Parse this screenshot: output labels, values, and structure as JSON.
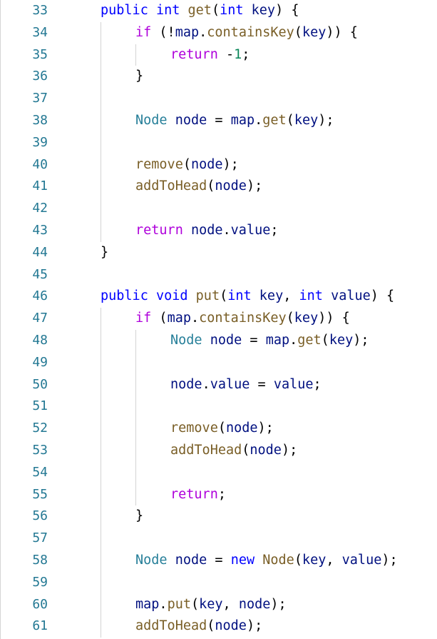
{
  "editor": {
    "lines": [
      {
        "n": "33",
        "indent": 1,
        "tokens": [
          [
            "kw",
            "public"
          ],
          [
            "pl",
            " "
          ],
          [
            "kw",
            "int"
          ],
          [
            "pl",
            " "
          ],
          [
            "fn",
            "get"
          ],
          [
            "pl",
            "("
          ],
          [
            "kw",
            "int"
          ],
          [
            "pl",
            " "
          ],
          [
            "var",
            "key"
          ],
          [
            "pl",
            ") {"
          ]
        ]
      },
      {
        "n": "34",
        "indent": 2,
        "tokens": [
          [
            "ctl",
            "if"
          ],
          [
            "pl",
            " (!"
          ],
          [
            "var",
            "map"
          ],
          [
            "pl",
            "."
          ],
          [
            "fn",
            "containsKey"
          ],
          [
            "pl",
            "("
          ],
          [
            "var",
            "key"
          ],
          [
            "pl",
            ")) {"
          ]
        ]
      },
      {
        "n": "35",
        "indent": 3,
        "tokens": [
          [
            "ctl",
            "return"
          ],
          [
            "pl",
            " -"
          ],
          [
            "num",
            "1"
          ],
          [
            "pl",
            ";"
          ]
        ]
      },
      {
        "n": "36",
        "indent": 2,
        "tokens": [
          [
            "pl",
            "}"
          ]
        ]
      },
      {
        "n": "37",
        "indent": 0,
        "tokens": []
      },
      {
        "n": "38",
        "indent": 2,
        "tokens": [
          [
            "ty",
            "Node"
          ],
          [
            "pl",
            " "
          ],
          [
            "var",
            "node"
          ],
          [
            "pl",
            " = "
          ],
          [
            "var",
            "map"
          ],
          [
            "pl",
            "."
          ],
          [
            "fn",
            "get"
          ],
          [
            "pl",
            "("
          ],
          [
            "var",
            "key"
          ],
          [
            "pl",
            ");"
          ]
        ]
      },
      {
        "n": "39",
        "indent": 0,
        "tokens": []
      },
      {
        "n": "40",
        "indent": 2,
        "tokens": [
          [
            "fn",
            "remove"
          ],
          [
            "pl",
            "("
          ],
          [
            "var",
            "node"
          ],
          [
            "pl",
            ");"
          ]
        ]
      },
      {
        "n": "41",
        "indent": 2,
        "tokens": [
          [
            "fn",
            "addToHead"
          ],
          [
            "pl",
            "("
          ],
          [
            "var",
            "node"
          ],
          [
            "pl",
            ");"
          ]
        ]
      },
      {
        "n": "42",
        "indent": 0,
        "tokens": []
      },
      {
        "n": "43",
        "indent": 2,
        "tokens": [
          [
            "ctl",
            "return"
          ],
          [
            "pl",
            " "
          ],
          [
            "var",
            "node"
          ],
          [
            "pl",
            "."
          ],
          [
            "var",
            "value"
          ],
          [
            "pl",
            ";"
          ]
        ]
      },
      {
        "n": "44",
        "indent": 1,
        "tokens": [
          [
            "pl",
            "}"
          ]
        ]
      },
      {
        "n": "45",
        "indent": 0,
        "tokens": []
      },
      {
        "n": "46",
        "indent": 1,
        "tokens": [
          [
            "kw",
            "public"
          ],
          [
            "pl",
            " "
          ],
          [
            "kw",
            "void"
          ],
          [
            "pl",
            " "
          ],
          [
            "fn",
            "put"
          ],
          [
            "pl",
            "("
          ],
          [
            "kw",
            "int"
          ],
          [
            "pl",
            " "
          ],
          [
            "var",
            "key"
          ],
          [
            "pl",
            ", "
          ],
          [
            "kw",
            "int"
          ],
          [
            "pl",
            " "
          ],
          [
            "var",
            "value"
          ],
          [
            "pl",
            ") {"
          ]
        ]
      },
      {
        "n": "47",
        "indent": 2,
        "tokens": [
          [
            "ctl",
            "if"
          ],
          [
            "pl",
            " ("
          ],
          [
            "var",
            "map"
          ],
          [
            "pl",
            "."
          ],
          [
            "fn",
            "containsKey"
          ],
          [
            "pl",
            "("
          ],
          [
            "var",
            "key"
          ],
          [
            "pl",
            ")) {"
          ]
        ]
      },
      {
        "n": "48",
        "indent": 3,
        "tokens": [
          [
            "ty",
            "Node"
          ],
          [
            "pl",
            " "
          ],
          [
            "var",
            "node"
          ],
          [
            "pl",
            " = "
          ],
          [
            "var",
            "map"
          ],
          [
            "pl",
            "."
          ],
          [
            "fn",
            "get"
          ],
          [
            "pl",
            "("
          ],
          [
            "var",
            "key"
          ],
          [
            "pl",
            ");"
          ]
        ]
      },
      {
        "n": "49",
        "indent": 0,
        "tokens": []
      },
      {
        "n": "50",
        "indent": 3,
        "tokens": [
          [
            "var",
            "node"
          ],
          [
            "pl",
            "."
          ],
          [
            "var",
            "value"
          ],
          [
            "pl",
            " = "
          ],
          [
            "var",
            "value"
          ],
          [
            "pl",
            ";"
          ]
        ]
      },
      {
        "n": "51",
        "indent": 0,
        "tokens": []
      },
      {
        "n": "52",
        "indent": 3,
        "tokens": [
          [
            "fn",
            "remove"
          ],
          [
            "pl",
            "("
          ],
          [
            "var",
            "node"
          ],
          [
            "pl",
            ");"
          ]
        ]
      },
      {
        "n": "53",
        "indent": 3,
        "tokens": [
          [
            "fn",
            "addToHead"
          ],
          [
            "pl",
            "("
          ],
          [
            "var",
            "node"
          ],
          [
            "pl",
            ");"
          ]
        ]
      },
      {
        "n": "54",
        "indent": 0,
        "tokens": []
      },
      {
        "n": "55",
        "indent": 3,
        "tokens": [
          [
            "ctl",
            "return"
          ],
          [
            "pl",
            ";"
          ]
        ]
      },
      {
        "n": "56",
        "indent": 2,
        "tokens": [
          [
            "pl",
            "}"
          ]
        ]
      },
      {
        "n": "57",
        "indent": 0,
        "tokens": []
      },
      {
        "n": "58",
        "indent": 2,
        "tokens": [
          [
            "ty",
            "Node"
          ],
          [
            "pl",
            " "
          ],
          [
            "var",
            "node"
          ],
          [
            "pl",
            " = "
          ],
          [
            "kw",
            "new"
          ],
          [
            "pl",
            " "
          ],
          [
            "fn",
            "Node"
          ],
          [
            "pl",
            "("
          ],
          [
            "var",
            "key"
          ],
          [
            "pl",
            ", "
          ],
          [
            "var",
            "value"
          ],
          [
            "pl",
            ");"
          ]
        ]
      },
      {
        "n": "59",
        "indent": 0,
        "tokens": []
      },
      {
        "n": "60",
        "indent": 2,
        "tokens": [
          [
            "var",
            "map"
          ],
          [
            "pl",
            "."
          ],
          [
            "fn",
            "put"
          ],
          [
            "pl",
            "("
          ],
          [
            "var",
            "key"
          ],
          [
            "pl",
            ", "
          ],
          [
            "var",
            "node"
          ],
          [
            "pl",
            ");"
          ]
        ]
      },
      {
        "n": "61",
        "indent": 2,
        "tokens": [
          [
            "fn",
            "addToHead"
          ],
          [
            "pl",
            "("
          ],
          [
            "var",
            "node"
          ],
          [
            "pl",
            ");"
          ]
        ]
      }
    ]
  }
}
